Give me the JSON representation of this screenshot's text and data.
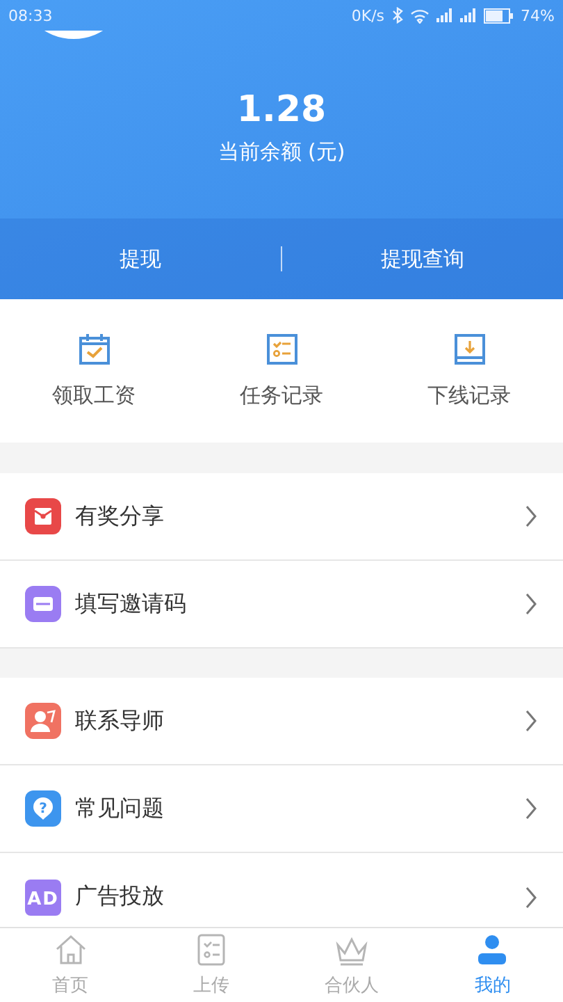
{
  "status_bar": {
    "time": "08:33",
    "speed": "0K/s",
    "battery": "74%"
  },
  "balance": {
    "amount": "1.28",
    "label": "当前余额 (元)"
  },
  "actions": [
    {
      "label": "提现"
    },
    {
      "label": "提现查询"
    }
  ],
  "quick_links": [
    {
      "label": "领取工资",
      "kind": "calendar"
    },
    {
      "label": "任务记录",
      "kind": "checklist"
    },
    {
      "label": "下线记录",
      "kind": "download"
    }
  ],
  "menu_groups": [
    [
      {
        "label": "有奖分享",
        "kind": "gift",
        "color": "#e84848"
      },
      {
        "label": "填写邀请码",
        "kind": "ticket",
        "color": "#9a7cf2"
      }
    ],
    [
      {
        "label": "联系导师",
        "kind": "mentor",
        "color": "#f07262"
      },
      {
        "label": "常见问题",
        "kind": "question",
        "color": "#3d95ee",
        "icon_text": "?"
      },
      {
        "label": "广告投放",
        "kind": "ad",
        "color": "#9a7cf2",
        "icon_text": "AD"
      }
    ]
  ],
  "tabs": [
    {
      "label": "首页",
      "kind": "home",
      "selected": false
    },
    {
      "label": "上传",
      "kind": "list",
      "selected": false
    },
    {
      "label": "合伙人",
      "kind": "crown",
      "selected": false
    },
    {
      "label": "我的",
      "kind": "person",
      "selected": true
    }
  ]
}
